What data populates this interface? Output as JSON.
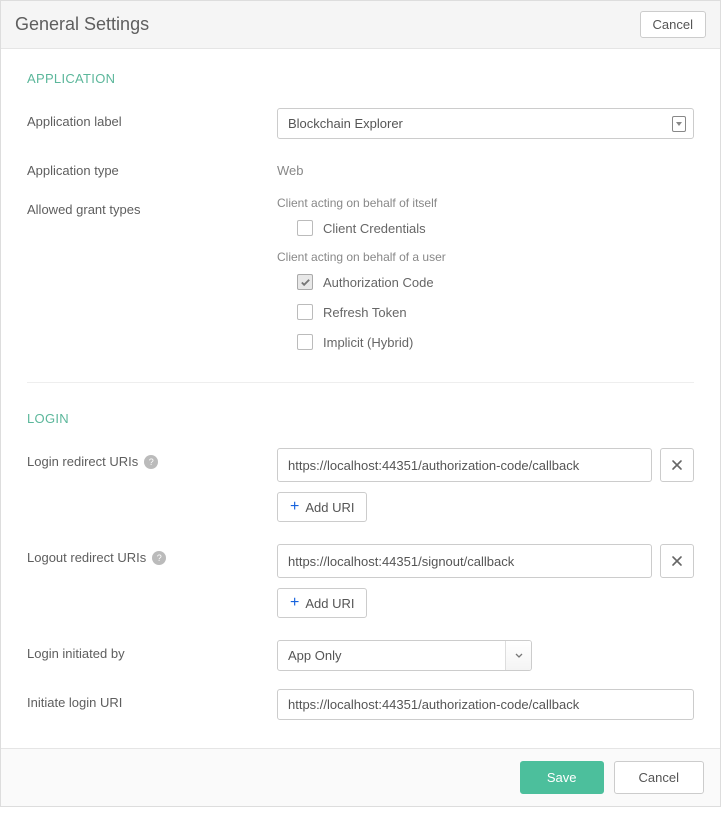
{
  "header": {
    "title": "General Settings",
    "cancel": "Cancel"
  },
  "application": {
    "section": "APPLICATION",
    "label_field": {
      "label": "Application label",
      "value": "Blockchain Explorer"
    },
    "type_field": {
      "label": "Application type",
      "value": "Web"
    },
    "grant": {
      "label": "Allowed grant types",
      "self_heading": "Client acting on behalf of itself",
      "user_heading": "Client acting on behalf of a user",
      "options": {
        "client_credentials": "Client Credentials",
        "authorization_code": "Authorization Code",
        "refresh_token": "Refresh Token",
        "implicit_hybrid": "Implicit (Hybrid)"
      }
    }
  },
  "login": {
    "section": "LOGIN",
    "login_redirect": {
      "label": "Login redirect URIs",
      "value": "https://localhost:44351/authorization-code/callback",
      "add": "Add URI"
    },
    "logout_redirect": {
      "label": "Logout redirect URIs",
      "value": "https://localhost:44351/signout/callback",
      "add": "Add URI"
    },
    "initiated_by": {
      "label": "Login initiated by",
      "value": "App Only"
    },
    "initiate_uri": {
      "label": "Initiate login URI",
      "value": "https://localhost:44351/authorization-code/callback"
    }
  },
  "footer": {
    "save": "Save",
    "cancel": "Cancel"
  }
}
